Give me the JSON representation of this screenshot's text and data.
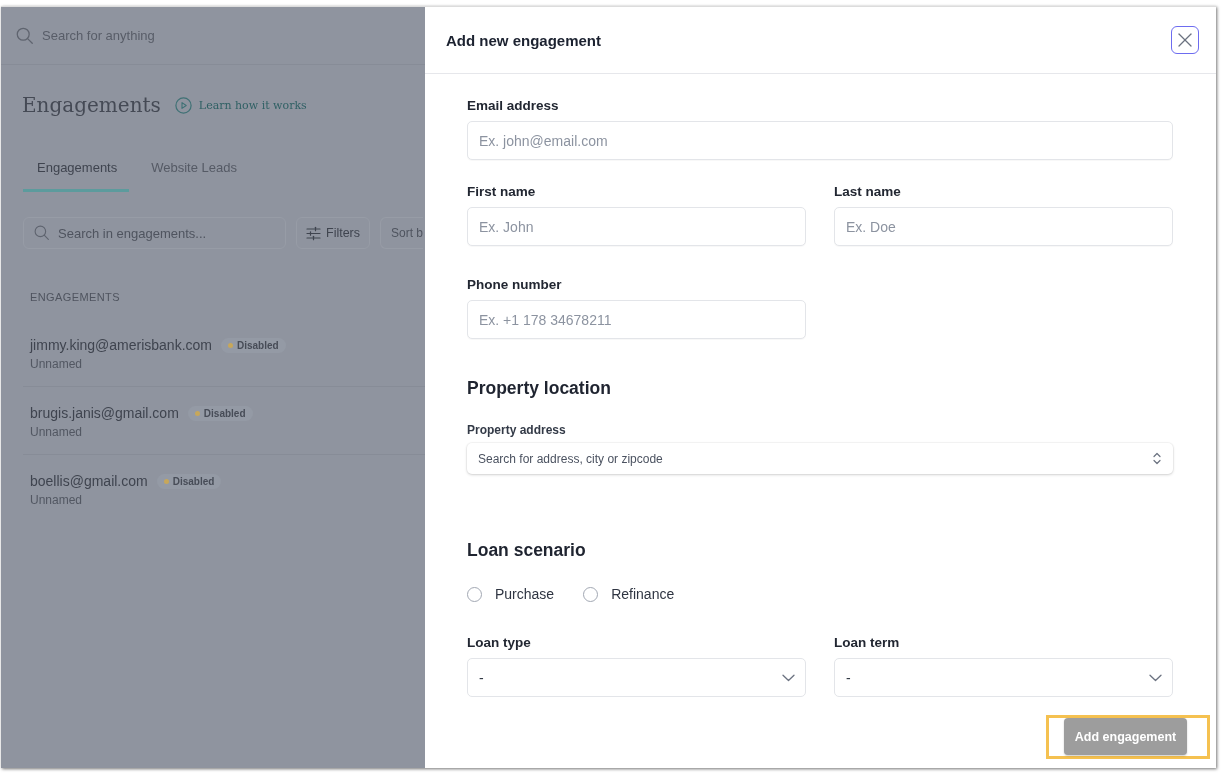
{
  "background_page": {
    "search": {
      "placeholder": "Search for anything"
    },
    "title": "Engagements",
    "help_link": "Learn how it works",
    "tabs": [
      {
        "label": "Engagements",
        "selected": true
      },
      {
        "label": "Website Leads",
        "selected": false
      }
    ],
    "list_search": {
      "placeholder": "Search in engagements..."
    },
    "filters_button": "Filters",
    "sort_button": "Sort b",
    "section_label": "ENGAGEMENTS",
    "engagements": [
      {
        "email": "jimmy.king@amerisbank.com",
        "status": "Disabled",
        "name": "Unnamed"
      },
      {
        "email": "brugis.janis@gmail.com",
        "status": "Disabled",
        "name": "Unnamed"
      },
      {
        "email": "boellis@gmail.com",
        "status": "Disabled",
        "name": "Unnamed"
      }
    ]
  },
  "modal": {
    "title": "Add new engagement",
    "close_button": {
      "focused": true
    },
    "email": {
      "label": "Email address",
      "placeholder": "Ex. john@email.com"
    },
    "name_fields": [
      {
        "label": "First name",
        "placeholder": "Ex. John"
      },
      {
        "label": "Last name",
        "placeholder": "Ex. Doe"
      }
    ],
    "phone": {
      "label": "Phone number",
      "placeholder": "Ex. +1 178 34678211"
    },
    "property_location": {
      "heading": "Property location",
      "address": {
        "label": "Property address",
        "placeholder": "Search for address, city or zipcode"
      }
    },
    "loan_scenario": {
      "heading": "Loan scenario",
      "options": [
        {
          "label": "Purchase",
          "selected": false
        },
        {
          "label": "Refinance",
          "selected": false
        }
      ],
      "selects": [
        {
          "label": "Loan type",
          "value": "-"
        },
        {
          "label": "Loan term",
          "value": "-"
        }
      ]
    },
    "submit": {
      "label": "Add engagement",
      "disabled": true,
      "highlighted": true
    }
  }
}
